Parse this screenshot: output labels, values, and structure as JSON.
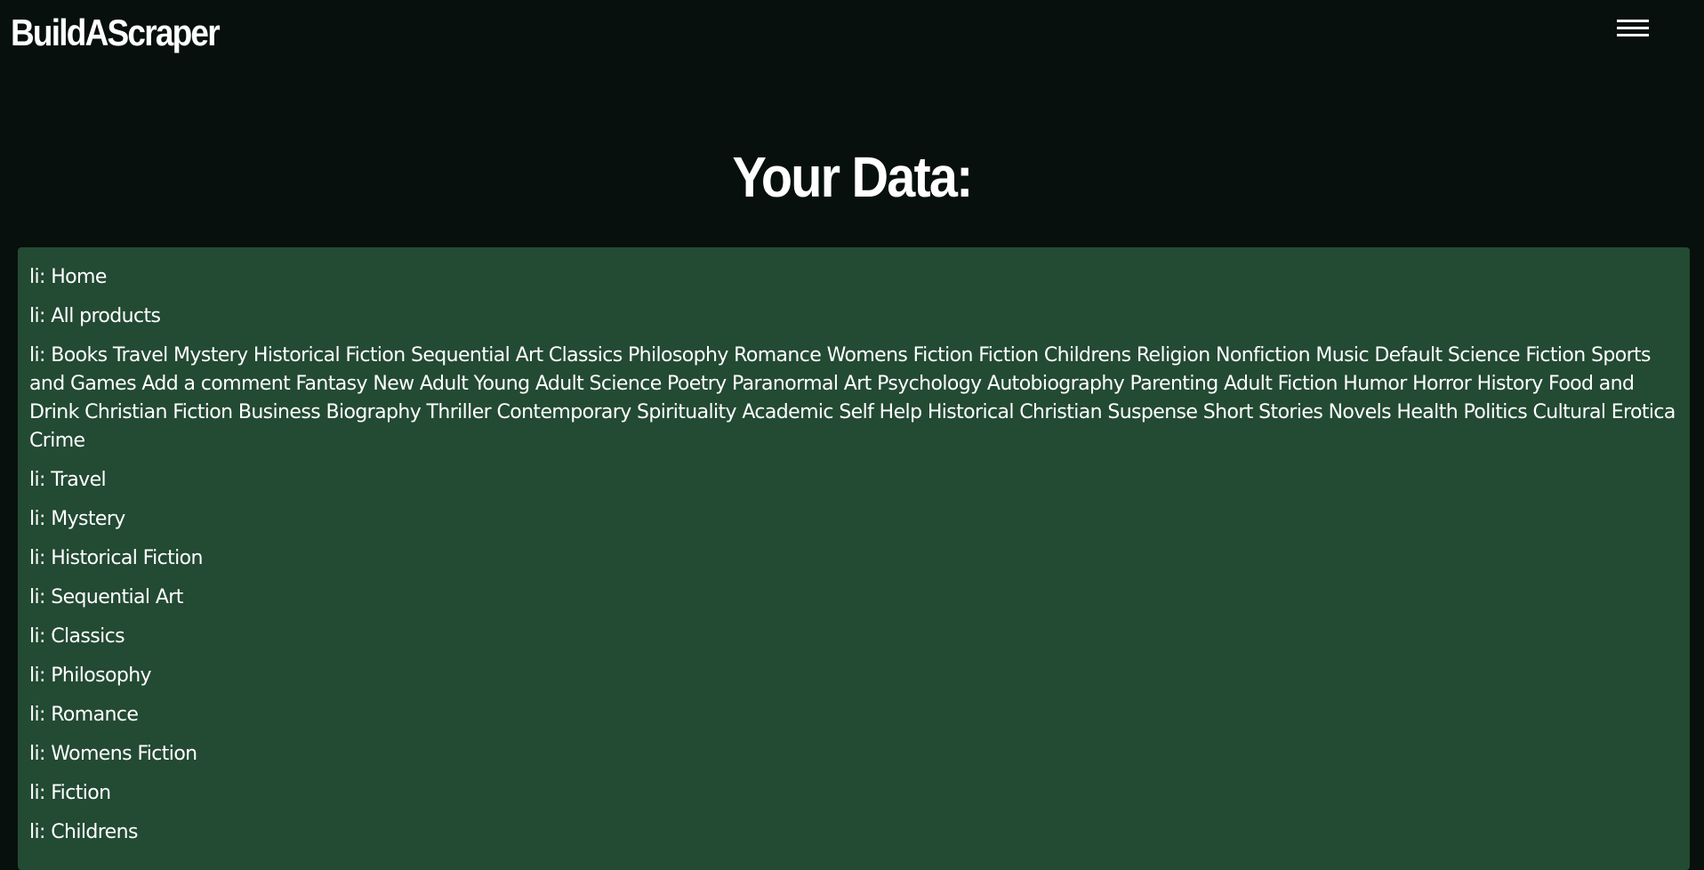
{
  "header": {
    "brand": "BuildAScraper",
    "menu_icon": "hamburger-menu-icon"
  },
  "main": {
    "title": "Your Data:",
    "items": [
      "li: Home",
      "li: All products",
      "li: Books Travel Mystery Historical Fiction Sequential Art Classics Philosophy Romance Womens Fiction Fiction Childrens Religion Nonfiction Music Default Science Fiction Sports and Games Add a comment Fantasy New Adult Young Adult Science Poetry Paranormal Art Psychology Autobiography Parenting Adult Fiction Humor Horror History Food and Drink Christian Fiction Business Biography Thriller Contemporary Spirituality Academic Self Help Historical Christian Suspense Short Stories Novels Health Politics Cultural Erotica Crime",
      "li: Travel",
      "li: Mystery",
      "li: Historical Fiction",
      "li: Sequential Art",
      "li: Classics",
      "li: Philosophy",
      "li: Romance",
      "li: Womens Fiction",
      "li: Fiction",
      "li: Childrens"
    ]
  },
  "colors": {
    "background": "#07100c",
    "panel": "#234a33",
    "text": "#ffffff"
  }
}
